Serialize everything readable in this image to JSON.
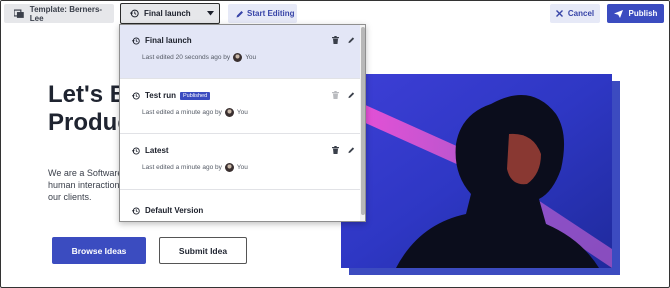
{
  "toolbar": {
    "template_label": "Template: Berners-Lee",
    "version_selected": "Final launch",
    "start_editing_label": "Start Editing",
    "cancel_label": "Cancel",
    "publish_label": "Publish"
  },
  "page": {
    "title_line1": "Let's B",
    "title_line2": "Produc",
    "text_line1": "We are a Software",
    "text_line2": "human interaction",
    "text_line3": "our clients.",
    "browse_label": "Browse Ideas",
    "submit_label": "Submit Idea"
  },
  "versions": [
    {
      "name": "Final launch",
      "meta": "Last edited 20 seconds ago by",
      "user": "You",
      "badge": ""
    },
    {
      "name": "Test run",
      "meta": "Last edited a minute ago by",
      "user": "You",
      "badge": "Published"
    },
    {
      "name": "Latest",
      "meta": "Last edited a minute ago by",
      "user": "You",
      "badge": ""
    },
    {
      "name": "Default Version",
      "meta": "",
      "user": "",
      "badge": ""
    }
  ],
  "colors": {
    "accent": "#3b4cc0",
    "active_item_bg": "#e3e6f6"
  }
}
